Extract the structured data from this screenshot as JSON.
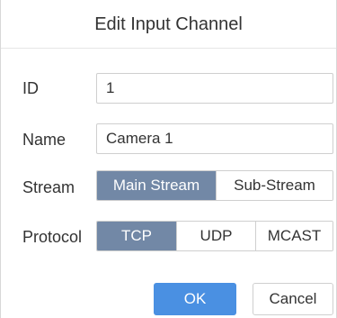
{
  "dialog": {
    "title": "Edit Input Channel"
  },
  "fields": {
    "id": {
      "label": "ID",
      "value": "1"
    },
    "name": {
      "label": "Name",
      "value": "Camera 1"
    },
    "stream": {
      "label": "Stream",
      "options": [
        "Main Stream",
        "Sub-Stream"
      ],
      "selected": "Main Stream"
    },
    "protocol": {
      "label": "Protocol",
      "options": [
        "TCP",
        "UDP",
        "MCAST"
      ],
      "selected": "TCP"
    }
  },
  "buttons": {
    "ok": "OK",
    "cancel": "Cancel"
  },
  "colors": {
    "active_segment": "#7288a6",
    "primary_button": "#4a90e2",
    "border": "#cfcfcf"
  }
}
